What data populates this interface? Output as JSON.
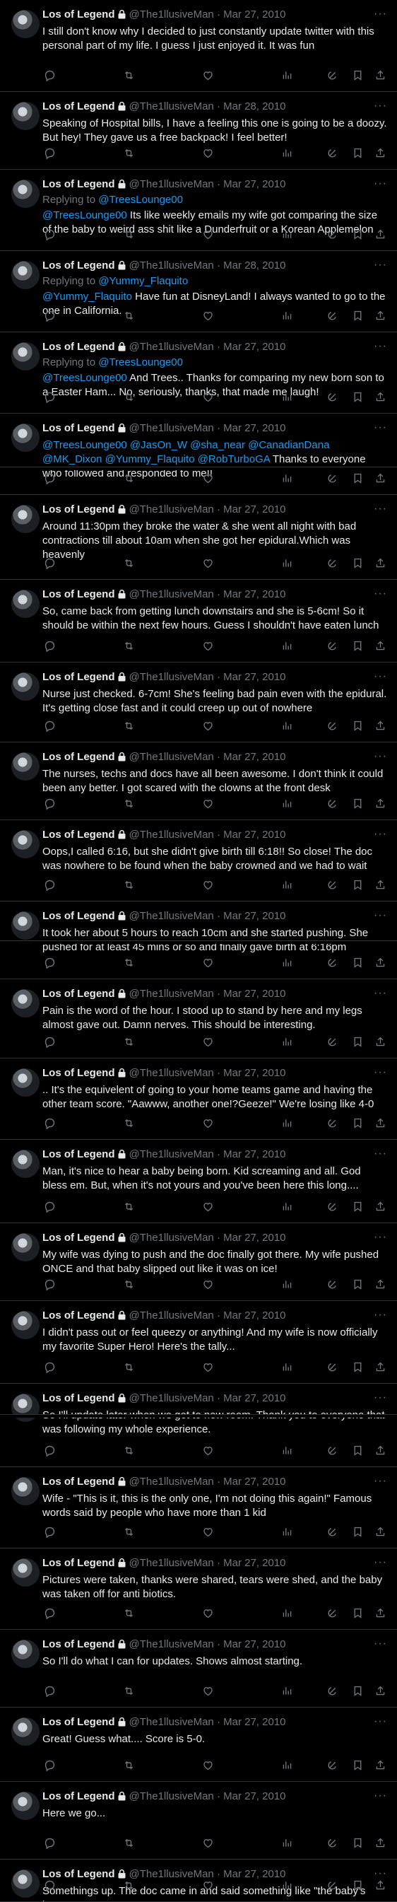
{
  "author": {
    "name": "Los of Legend",
    "handle": "@The1llusiveMan",
    "separator": "·"
  },
  "reply_prefix": "Replying to",
  "tweets": [
    {
      "date": "Mar 27, 2010",
      "text": "I still don't know why I decided to just constantly update twitter with this personal part of my life. I guess I just enjoyed it. It was fun"
    },
    {
      "date": "Mar 28, 2010",
      "text": "Speaking of Hospital bills, I have a feeling this one is going to be a doozy. But hey! They gave us a free backpack! I feel better!"
    },
    {
      "date": "Mar 27, 2010",
      "reply_to": "@TreesLounge00",
      "mention": "@TreesLounge00",
      "text": " Its like weekly emails my wife got comparing the size of the baby to weird ass shit like a Dunderfruit or a Korean Applemelon"
    },
    {
      "date": "Mar 28, 2010",
      "reply_to": "@Yummy_Flaquito",
      "mention": "@Yummy_Flaquito",
      "text": " Have fun at DisneyLand! I always wanted to go to the one in California."
    },
    {
      "date": "Mar 27, 2010",
      "reply_to": "@TreesLounge00",
      "mention": "@TreesLounge00",
      "text": " And Trees.. Thanks for comparing my new born son to a Easter Ham... No, seriously, thanks, that made me laugh!"
    },
    {
      "date": "Mar 27, 2010",
      "mention": "@TreesLounge00 @JasOn_W @sha_near @CanadianDana @MK_Dixon @Yummy_Flaquito @RobTurboGA",
      "text": " Thanks to everyone who followed and responded to me!!"
    },
    {
      "date": "Mar 27, 2010",
      "text": "Around 11:30pm they broke the water & she went all night with bad contractions till about 10am when she got her epidural.Which was heavenly"
    },
    {
      "date": "Mar 27, 2010",
      "text": "So, came back from getting lunch downstairs and she is 5-6cm! So it should be within the next few hours. Guess I shouldn't have eaten lunch"
    },
    {
      "date": "Mar 27, 2010",
      "text": "Nurse just checked. 6-7cm! She's feeling bad pain even with the epidural. It's getting close fast and it could creep up out of nowhere"
    },
    {
      "date": "Mar 27, 2010",
      "text": "The nurses, techs and docs have all been awesome. I don't think it could been any better. I got scared with the clowns at the front desk"
    },
    {
      "date": "Mar 27, 2010",
      "text": "Oops,I called 6:16, but she didn't give birth till 6:18!! So close! The doc was nowhere to be found when the baby crowned and we had to wait"
    },
    {
      "date": "Mar 27, 2010",
      "text": "It took her about 5 hours to reach 10cm and she started pushing. She pushed for at least 45 mins or so and finally gave birth at 6:16pm"
    },
    {
      "date": "Mar 27, 2010",
      "text": "Pain is the word of the hour. I stood up to stand by here and my legs almost gave out. Damn nerves. This should be interesting."
    },
    {
      "date": "Mar 27, 2010",
      "text": ".. It's the equivelent of going to your home teams game and having the other team score. \"Aawww, another one!?Geeze!\" We're losing like 4-0"
    },
    {
      "date": "Mar 27, 2010",
      "text": "Man, it's nice to hear a baby being born. Kid screaming and all. God bless em. But, when it's not yours and you've been here this long...."
    },
    {
      "date": "Mar 27, 2010",
      "text": "My wife was dying to push and the doc finally got there. My wife pushed ONCE and that baby slipped out like it was on ice!"
    },
    {
      "date": "Mar 27, 2010",
      "text": "I didn't pass out or feel queezy or anything! And my wife is now officially my favorite Super Hero! Here's the tally..."
    },
    {
      "date": "Mar 27, 2010",
      "text": "So I'll update later when we get to new room. Thank you to everyone that was following my whole experience."
    },
    {
      "date": "Mar 27, 2010",
      "text": "Wife - \"This is it, this is the only one, I'm not doing this again!\" Famous words said by people who have more than 1 kid"
    },
    {
      "date": "Mar 27, 2010",
      "text": "Pictures were taken, thanks were shared, tears were shed, and the baby was taken off for anti biotics."
    },
    {
      "date": "Mar 27, 2010",
      "text": "So I'll do what I can for updates. Shows almost starting."
    },
    {
      "date": "Mar 27, 2010",
      "text": "Great! Guess what.... Score is 5-0."
    },
    {
      "date": "Mar 27, 2010",
      "text": "Here we go..."
    },
    {
      "date": "Mar 27, 2010",
      "text": "Somethings up. The doc came in and said something like \"the baby's heart rate"
    }
  ]
}
